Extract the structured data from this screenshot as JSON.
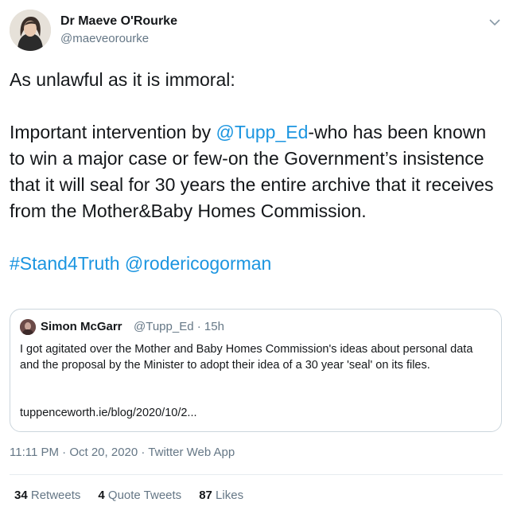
{
  "author": {
    "name": "Dr Maeve O'Rourke",
    "handle": "@maeveorourke"
  },
  "tweet": {
    "line1": "As unlawful as it is immoral:",
    "para_prefix": "Important intervention by ",
    "mention_tupp": "@Tupp_Ed",
    "para_suffix": "-who has been known to win a major case or few-on the Government’s insistence that it will seal for 30 years the entire archive that it receives from the Mother&Baby Homes Commission.",
    "hashtag": "#Stand4Truth",
    "mention_roderic": "@rodericogorman"
  },
  "quote": {
    "name": "Simon McGarr",
    "meta": "@Tupp_Ed · 15h",
    "text": "I got agitated over the Mother and Baby Homes Commission's ideas about personal data and the proposal by the Minister to adopt their idea of a 30 year 'seal' on its files.",
    "link": "tuppenceworth.ie/blog/2020/10/2..."
  },
  "timestamp": {
    "time": "11:11 PM",
    "date": "Oct 20, 2020",
    "source": "Twitter Web App",
    "sep": " · "
  },
  "stats": {
    "retweets_count": "34",
    "retweets_label": "Retweets",
    "quotes_count": "4",
    "quotes_label": "Quote Tweets",
    "likes_count": "87",
    "likes_label": "Likes"
  },
  "icons": {
    "caret": "chevron-down-icon",
    "avatar": "profile-photo",
    "quote_avatar": "profile-photo"
  },
  "colors": {
    "link": "#1b95e0",
    "muted": "#657786",
    "text": "#14171a",
    "border": "#ccd6dd"
  }
}
